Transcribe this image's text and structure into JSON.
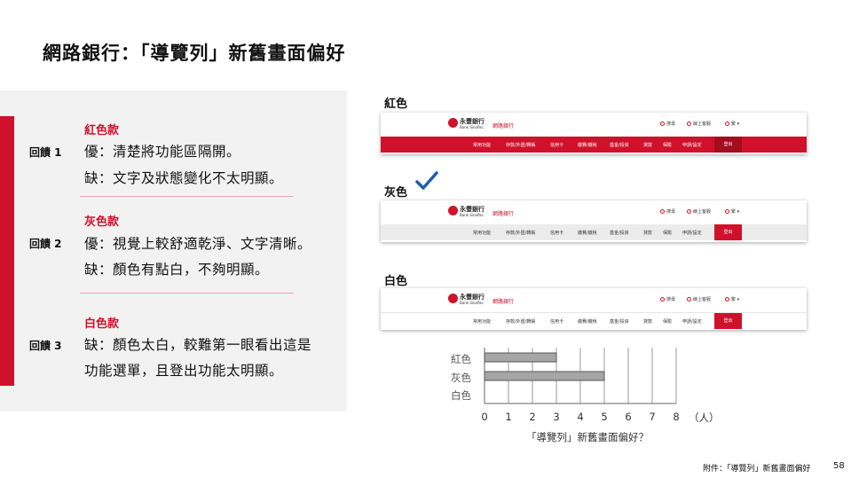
{
  "title": "網路銀行：「導覽列」新舊畫面偏好",
  "feedback": [
    {
      "label": "回饋 1",
      "heading": "紅色款",
      "lines": [
        "優：清楚將功能區隔開。",
        "缺：文字及狀態變化不太明顯。"
      ]
    },
    {
      "label": "回饋 2",
      "heading": "灰色款",
      "lines": [
        "優：視覺上較舒適乾淨、文字清晰。",
        "缺：顏色有點白，不夠明顯。"
      ]
    },
    {
      "label": "回饋 3",
      "heading": "白色款",
      "lines": [
        "缺：顏色太白，較難第一眼看出這是",
        "功能選單，且登出功能太明顯。"
      ]
    }
  ],
  "variants": [
    {
      "label": "紅色",
      "nav_bg": "#d0112b",
      "nav_text": "#ffffff",
      "logout_bg": "#a30d20"
    },
    {
      "label": "灰色",
      "nav_bg": "#ececec",
      "nav_text": "#333333",
      "logout_bg": "#d0112b"
    },
    {
      "label": "白色",
      "nav_bg": "#ffffff",
      "nav_text": "#333333",
      "logout_bg": "#d0112b"
    }
  ],
  "chosen_icon": "checkmark-icon",
  "mock_header": {
    "logo_name": "永豐銀行",
    "logo_en": "Bank SinoPac",
    "site_name": "網路銀行",
    "util": [
      "搜尋",
      "線上客服",
      "繁"
    ],
    "nav_items": [
      "常用功能",
      "存款/外匯/轉帳",
      "信用卡",
      "繳費/繳稅",
      "基金/投資",
      "貸款",
      "保險",
      "申請/設定"
    ],
    "logout": "登出"
  },
  "chart_data": {
    "type": "bar",
    "orientation": "horizontal",
    "categories": [
      "紅色",
      "灰色",
      "白色"
    ],
    "values": [
      3,
      5,
      0
    ],
    "xlim": [
      0,
      8
    ],
    "xticks": [
      "0",
      "1",
      "2",
      "3",
      "4",
      "5",
      "6",
      "7",
      "8"
    ],
    "unit_label": "（人）",
    "caption": "「導覽列」新舊畫面偏好？",
    "grid": true,
    "bar_color": "#a6a6a6"
  },
  "footnote": "附件：「導覽列」新舊畫面偏好",
  "page_number": "58"
}
